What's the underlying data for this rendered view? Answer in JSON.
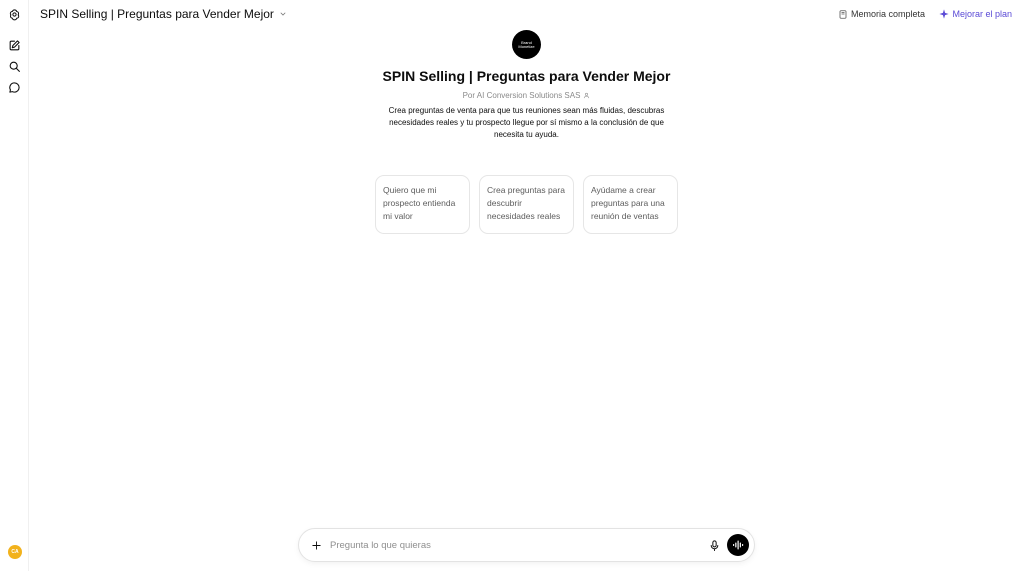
{
  "header": {
    "title": "SPIN Selling | Preguntas para Vender Mejor",
    "memory_label": "Memoria completa",
    "upgrade_label": "Mejorar el plan"
  },
  "gpt": {
    "logo_text": "Brand Monetize",
    "name": "SPIN Selling | Preguntas para Vender Mejor",
    "byline": "Por AI Conversion Solutions SAS",
    "description": "Crea preguntas de venta para que tus reuniones sean más fluidas, descubras necesidades reales y tu prospecto llegue por sí mismo a la conclusión de que necesita tu ayuda."
  },
  "starters": [
    {
      "label": "Quiero que mi prospecto entienda mi valor"
    },
    {
      "label": "Crea preguntas para descubrir necesidades reales"
    },
    {
      "label": "Ayúdame a crear preguntas para una reunión de ventas"
    }
  ],
  "composer": {
    "placeholder": "Pregunta lo que quieras",
    "value": ""
  },
  "user": {
    "avatar_initials": "CA"
  },
  "colors": {
    "accent": "#5b4bd6",
    "avatar": "#f2b21c",
    "border": "#e6e6e6"
  }
}
